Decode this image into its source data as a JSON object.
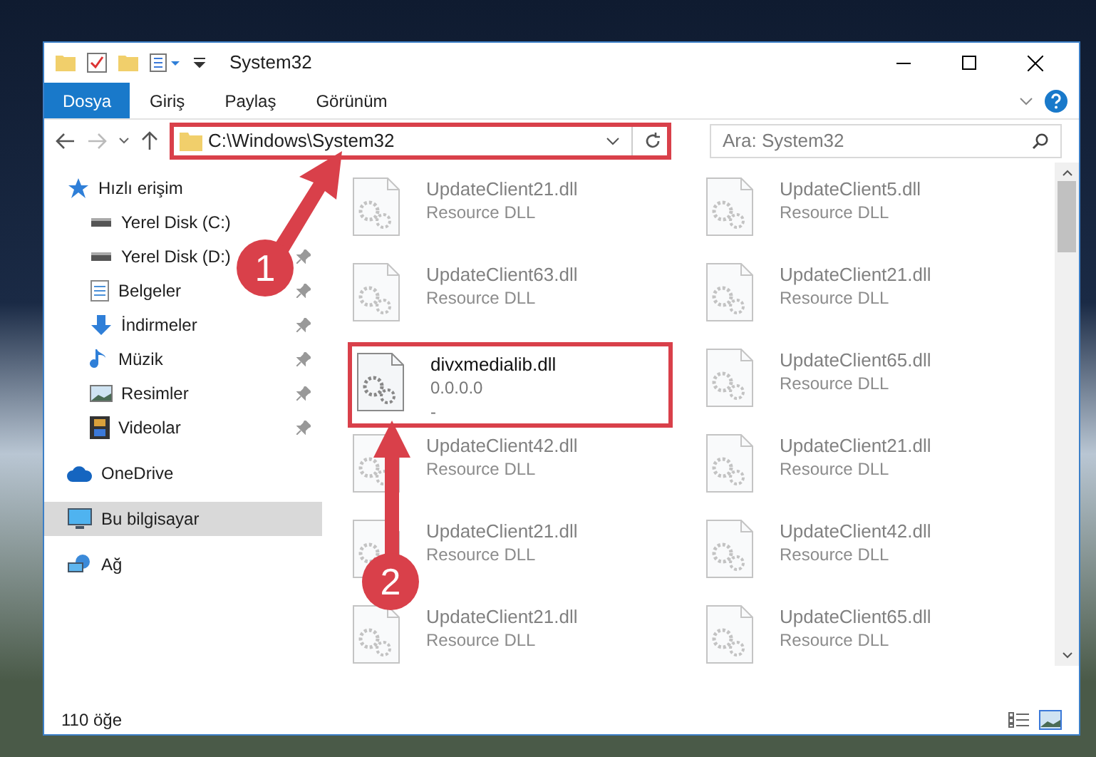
{
  "window": {
    "title": "System32"
  },
  "ribbon_tabs": [
    {
      "label": "Dosya",
      "selected": true
    },
    {
      "label": "Giriş",
      "selected": false
    },
    {
      "label": "Paylaş",
      "selected": false
    },
    {
      "label": "Görünüm",
      "selected": false
    }
  ],
  "address": {
    "path": "C:\\Windows\\System32",
    "highlighted": true
  },
  "search": {
    "placeholder": "Ara: System32"
  },
  "sidebar": {
    "items": [
      {
        "label": "Hızlı erişim",
        "kind": "star",
        "selected": false,
        "children": [
          {
            "label": "Yerel Disk (C:)",
            "kind": "drive",
            "pinned": false
          },
          {
            "label": "Yerel Disk (D:)",
            "kind": "drive",
            "pinned": true
          },
          {
            "label": "Belgeler",
            "kind": "doc",
            "pinned": true
          },
          {
            "label": "İndirmeler",
            "kind": "download",
            "pinned": true
          },
          {
            "label": "Müzik",
            "kind": "music",
            "pinned": true
          },
          {
            "label": "Resimler",
            "kind": "picture",
            "pinned": true
          },
          {
            "label": "Videolar",
            "kind": "video",
            "pinned": true
          }
        ]
      },
      {
        "label": "OneDrive",
        "kind": "cloud",
        "selected": false
      },
      {
        "label": "Bu bilgisayar",
        "kind": "computer",
        "selected": true
      },
      {
        "label": "Ağ",
        "kind": "network",
        "selected": false
      }
    ]
  },
  "files": [
    {
      "name": "UpdateClient21.dll",
      "detail": "Resource DLL",
      "highlighted": false
    },
    {
      "name": "UpdateClient5.dll",
      "detail": "Resource DLL",
      "highlighted": false
    },
    {
      "name": "UpdateClient63.dll",
      "detail": "Resource DLL",
      "highlighted": false
    },
    {
      "name": "UpdateClient21.dll",
      "detail": "Resource DLL",
      "highlighted": false
    },
    {
      "name": "divxmedialib.dll",
      "detail": "0.0.0.0",
      "extra": "-",
      "highlighted": true
    },
    {
      "name": "UpdateClient65.dll",
      "detail": "Resource DLL",
      "highlighted": false
    },
    {
      "name": "UpdateClient42.dll",
      "detail": "Resource DLL",
      "highlighted": false
    },
    {
      "name": "UpdateClient21.dll",
      "detail": "Resource DLL",
      "highlighted": false
    },
    {
      "name": "UpdateClient21.dll",
      "detail": "Resource DLL",
      "highlighted": false
    },
    {
      "name": "UpdateClient42.dll",
      "detail": "Resource DLL",
      "highlighted": false
    },
    {
      "name": "UpdateClient21.dll",
      "detail": "Resource DLL",
      "highlighted": false
    },
    {
      "name": "UpdateClient65.dll",
      "detail": "Resource DLL",
      "highlighted": false
    }
  ],
  "status_bar": {
    "count": "110 öğe"
  },
  "annotations": [
    {
      "number": "1"
    },
    {
      "number": "2"
    }
  ]
}
